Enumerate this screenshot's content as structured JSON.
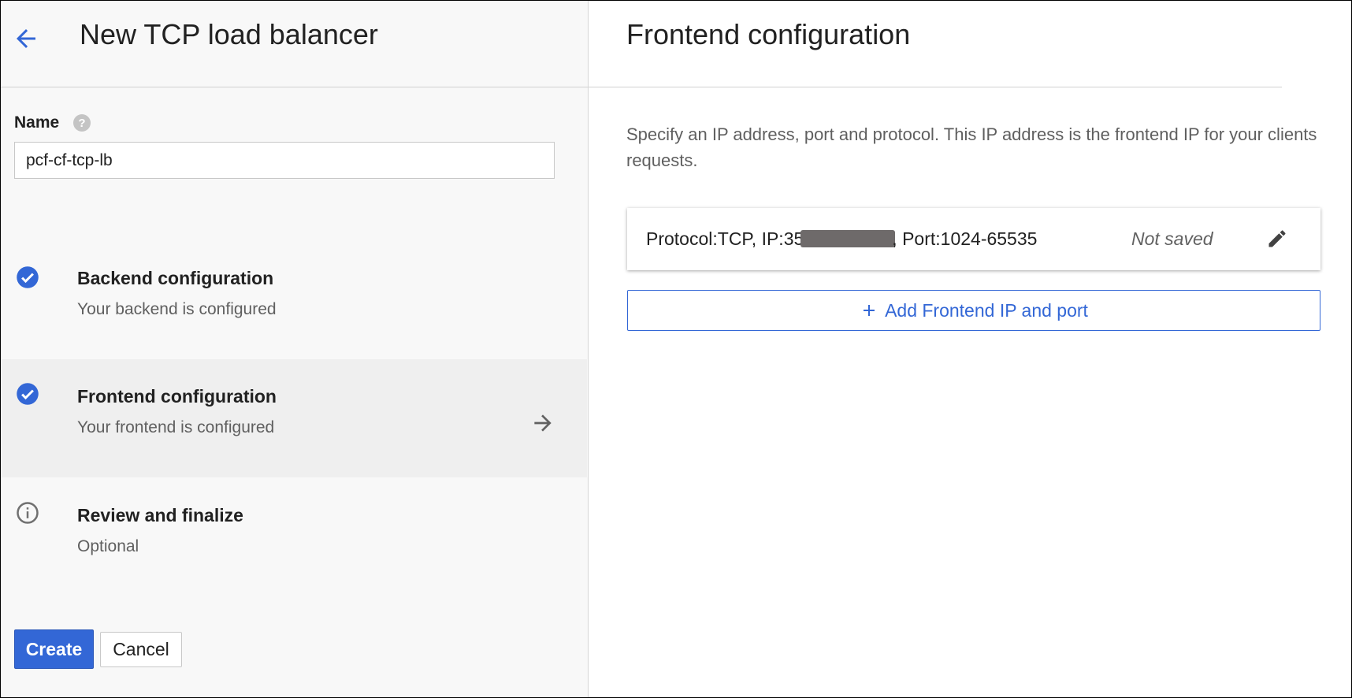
{
  "left": {
    "title": "New TCP load balancer",
    "name_label": "Name",
    "name_value": "pcf-cf-tcp-lb",
    "icons": {
      "back": "arrow-back-icon",
      "help": "help-circle-icon"
    }
  },
  "steps": [
    {
      "title": "Backend configuration",
      "subtitle": "Your backend is configured",
      "status_icon": "check-circle-icon",
      "active": false
    },
    {
      "title": "Frontend configuration",
      "subtitle": "Your frontend is configured",
      "status_icon": "check-circle-icon",
      "active": true
    },
    {
      "title": "Review and finalize",
      "subtitle": "Optional",
      "status_icon": "info-circle-icon",
      "active": false
    }
  ],
  "actions": {
    "create_label": "Create",
    "cancel_label": "Cancel"
  },
  "right": {
    "title": "Frontend configuration",
    "description": "Specify an IP address, port and protocol. This IP address is the frontend IP for your clients requests.",
    "frontend_entry": {
      "prefix": "Protocol:TCP, IP:35",
      "suffix": ", Port:1024-65535",
      "status": "Not saved"
    },
    "add_button_label": "Add Frontend IP and port"
  },
  "colors": {
    "accent": "#3367d6",
    "check": "#3367d6",
    "muted_text": "#5f5f5f",
    "active_step_bg": "#efefef"
  }
}
